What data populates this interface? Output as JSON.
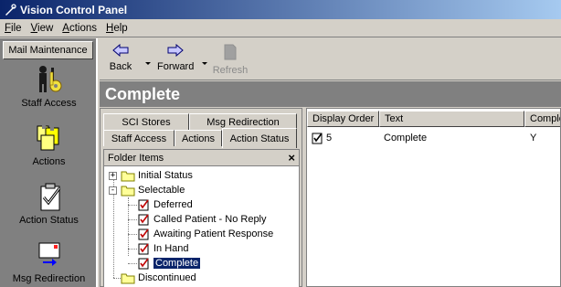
{
  "window": {
    "title": "Vision Control Panel"
  },
  "menu": [
    "File",
    "View",
    "Actions",
    "Help"
  ],
  "outlook_bar": {
    "header": "Mail Maintenance",
    "items": [
      "Staff Access",
      "Actions",
      "Action Status",
      "Msg Redirection"
    ]
  },
  "toolbar": {
    "back": "Back",
    "forward": "Forward",
    "refresh": "Refresh"
  },
  "page": {
    "title": "Complete"
  },
  "tabs": {
    "row1": [
      "SCI Stores",
      "Msg Redirection"
    ],
    "row2": [
      "Staff Access",
      "Actions",
      "Action Status"
    ],
    "active": "Action Status"
  },
  "folder": {
    "header": "Folder Items",
    "close": "×",
    "tree": [
      {
        "label": "Initial Status",
        "level": 0,
        "expander": "+"
      },
      {
        "label": "Selectable",
        "level": 0,
        "expander": "-"
      },
      {
        "label": "Deferred",
        "level": 1
      },
      {
        "label": "Called Patient - No Reply",
        "level": 1
      },
      {
        "label": "Awaiting Patient Response",
        "level": 1
      },
      {
        "label": "In Hand",
        "level": 1
      },
      {
        "label": "Complete",
        "level": 1,
        "selected": true
      },
      {
        "label": "Discontinued",
        "level": 0
      }
    ]
  },
  "list": {
    "columns": [
      "Display Order",
      "Text",
      "Complete"
    ],
    "rows": [
      {
        "order": "5",
        "text": "Complete",
        "complete": "Y"
      }
    ]
  },
  "colors": {
    "title_start": "#0a246a",
    "title_end": "#a6caf0",
    "selection": "#0a246a",
    "face": "#d4d0c8",
    "dark": "#808080"
  }
}
